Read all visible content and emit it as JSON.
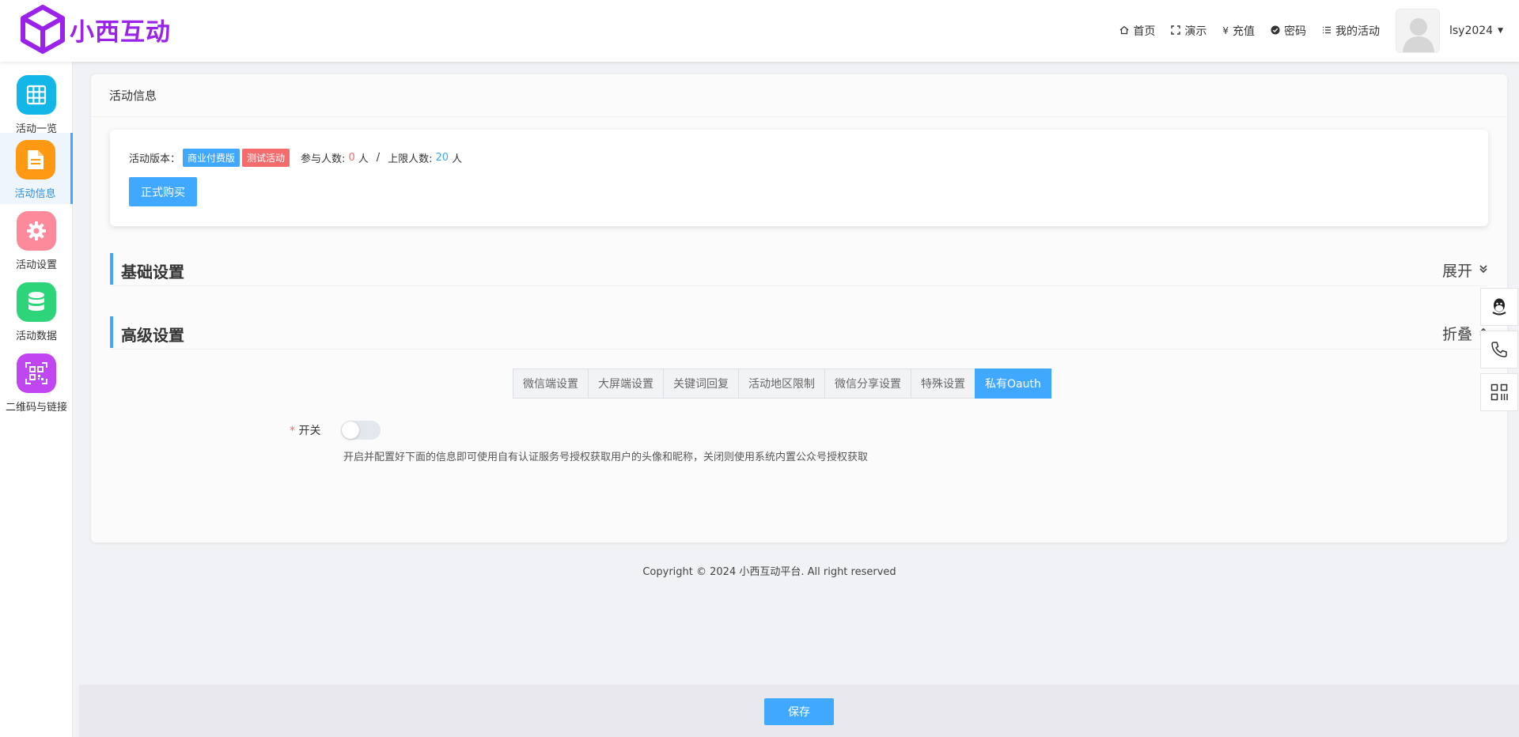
{
  "app": {
    "logo_text": "小西互动",
    "brand_color": "#9b22e8",
    "accent_color": "#40a9ff"
  },
  "topnav": {
    "items": [
      {
        "icon": "home-icon",
        "label": "首页"
      },
      {
        "icon": "fullscreen-icon",
        "label": "演示"
      },
      {
        "icon": "yen-icon",
        "label": "充值"
      },
      {
        "icon": "check-circle-icon",
        "label": "密码"
      },
      {
        "icon": "list-icon",
        "label": "我的活动"
      }
    ],
    "username": "lsy2024"
  },
  "sidebar": {
    "items": [
      {
        "label": "活动一览",
        "icon": "grid-icon",
        "color": "#12b7e8",
        "active": false
      },
      {
        "label": "活动信息",
        "icon": "document-icon",
        "color": "#ff9914",
        "active": true
      },
      {
        "label": "活动设置",
        "icon": "gear-icon",
        "color": "#fd8a9b",
        "active": false
      },
      {
        "label": "活动数据",
        "icon": "database-icon",
        "color": "#2ed47a",
        "active": false
      },
      {
        "label": "二维码与链接",
        "icon": "qrcode-icon",
        "color": "#c046f2",
        "active": false
      }
    ]
  },
  "panel": {
    "title": "活动信息",
    "info": {
      "version_label": "活动版本：",
      "tag_paid": "商业付费版",
      "tag_test": "测试活动",
      "participants_label": "参与人数:",
      "participants_value": "0",
      "participants_unit": "人",
      "separator": "/",
      "limit_label": "上限人数:",
      "limit_value": "20",
      "limit_unit": "人",
      "buy_button": "正式购买"
    },
    "sections": {
      "basic": {
        "title": "基础设置",
        "toggle": "展开"
      },
      "advanced": {
        "title": "高级设置",
        "toggle": "折叠"
      }
    },
    "tabs": [
      "微信端设置",
      "大屏端设置",
      "关键词回复",
      "活动地区限制",
      "微信分享设置",
      "特殊设置",
      "私有Oauth"
    ],
    "active_tab": "私有Oauth",
    "switch": {
      "label_star": "*",
      "label": "开关",
      "on": false,
      "help": "开启并配置好下面的信息即可使用自有认证服务号授权获取用户的头像和昵称，关闭则使用系统内置公众号授权获取"
    }
  },
  "copyright": "Copyright © 2024 小西互动平台. All right reserved",
  "footer": {
    "save_button": "保存"
  },
  "float_tools": [
    "qq-icon",
    "phone-icon",
    "qrcode-icon"
  ]
}
